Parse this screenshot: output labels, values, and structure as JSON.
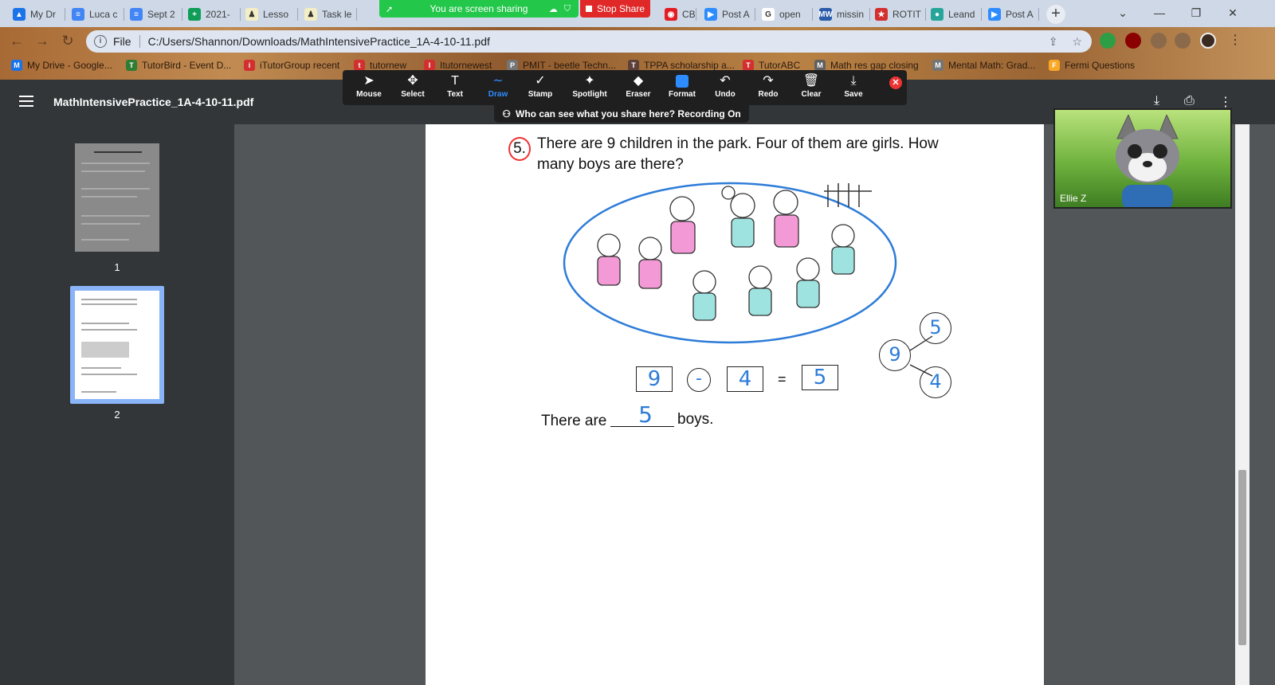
{
  "tabs": [
    {
      "label": "My Dr",
      "color": "#1a73e8",
      "glyph": "▲"
    },
    {
      "label": "Luca c",
      "color": "#4285f4",
      "glyph": "≡"
    },
    {
      "label": "Sept 2",
      "color": "#4285f4",
      "glyph": "≡"
    },
    {
      "label": "2021-",
      "color": "#0f9d58",
      "glyph": "+"
    },
    {
      "label": "Lesso",
      "color": "#f4eec4",
      "glyph": "♟"
    },
    {
      "label": "Task le",
      "color": "#f4eec4",
      "glyph": "♟"
    },
    {
      "label": "CBC N",
      "color": "#e31b23",
      "glyph": "◉"
    },
    {
      "label": "Post A",
      "color": "#2d8cff",
      "glyph": "▶"
    },
    {
      "label": "open",
      "color": "#ffffff",
      "glyph": "G"
    },
    {
      "label": "missin",
      "color": "#2a5caa",
      "glyph": "MW"
    },
    {
      "label": "ROTIT",
      "color": "#d32f2f",
      "glyph": "★"
    },
    {
      "label": "Leand",
      "color": "#26a69a",
      "glyph": "●"
    },
    {
      "label": "Post A",
      "color": "#2d8cff",
      "glyph": "▶"
    }
  ],
  "screen_share": {
    "banner": "You are screen sharing",
    "stop": "Stop Share"
  },
  "window_controls": {
    "menu": "⌄",
    "minimize": "—",
    "restore": "❐",
    "close": "✕"
  },
  "address": {
    "protocol": "File",
    "url": "C:/Users/Shannon/Downloads/MathIntensivePractice_1A-4-10-11.pdf"
  },
  "bookmarks": [
    {
      "label": "My Drive - Google...",
      "color": "#1a73e8"
    },
    {
      "label": "TutorBird - Event D...",
      "color": "#2e7d32"
    },
    {
      "label": "iTutorGroup recent",
      "color": "#d32f2f"
    },
    {
      "label": "tutornew",
      "color": "#d32f2f"
    },
    {
      "label": "Itutornewest",
      "color": "#d32f2f"
    },
    {
      "label": "PMIT - beetle Techn...",
      "color": "#757575"
    },
    {
      "label": "TPPA scholarship a...",
      "color": "#5d4037"
    },
    {
      "label": "TutorABC",
      "color": "#d32f2f"
    },
    {
      "label": "Math res gap closing",
      "color": "#616161"
    },
    {
      "label": "Mental Math: Grad...",
      "color": "#757575"
    },
    {
      "label": "Fermi Questions",
      "color": "#f9a825"
    }
  ],
  "pdf": {
    "filename": "MathIntensivePractice_1A-4-10-11.pdf",
    "pages": [
      "1",
      "2"
    ]
  },
  "annotate": {
    "tools": [
      "Mouse",
      "Select",
      "Text",
      "Draw",
      "Stamp",
      "Spotlight",
      "Eraser",
      "Format",
      "Undo",
      "Redo",
      "Clear",
      "Save"
    ],
    "active": "Draw",
    "recording": "Who can see what you share here? Recording On"
  },
  "question": {
    "number": "5.",
    "text": "There are 9 children in the park. Four of them are girls. How many boys are there?",
    "eq": {
      "a": "9",
      "op": "-",
      "b": "4",
      "eq": "=",
      "c": "5"
    },
    "bond": {
      "whole": "9",
      "part1": "5",
      "part2": "4"
    },
    "answer_prefix": "There are",
    "answer_value": "5",
    "answer_suffix": "boys."
  },
  "video": {
    "name": "Ellie Z"
  }
}
